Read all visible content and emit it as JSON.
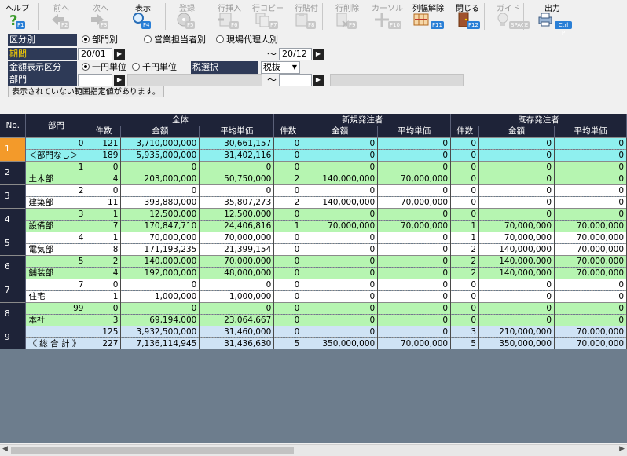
{
  "toolbar": [
    {
      "label": "ヘルプ",
      "key": "F1",
      "icon": "help-icon",
      "enabled": true
    },
    {
      "label": "前へ",
      "key": "F2",
      "icon": "arrow-left-icon",
      "enabled": false
    },
    {
      "label": "次へ",
      "key": "F3",
      "icon": "arrow-right-icon",
      "enabled": false
    },
    {
      "label": "表示",
      "key": "F4",
      "icon": "search-icon",
      "enabled": true
    },
    {
      "label": "登録",
      "key": "F5",
      "icon": "disk-icon",
      "enabled": false
    },
    {
      "label": "行挿入",
      "key": "F6",
      "icon": "row-insert-icon",
      "enabled": false
    },
    {
      "label": "行コピー",
      "key": "F7",
      "icon": "row-copy-icon",
      "enabled": false
    },
    {
      "label": "行貼付",
      "key": "F8",
      "icon": "row-paste-icon",
      "enabled": false
    },
    {
      "label": "行削除",
      "key": "F9",
      "icon": "row-delete-icon",
      "enabled": false
    },
    {
      "label": "カーソル",
      "key": "F10",
      "icon": "cursor-icon",
      "enabled": false
    },
    {
      "label": "列幅解除",
      "key": "F11",
      "icon": "column-width-icon",
      "enabled": true
    },
    {
      "label": "閉じる",
      "key": "F12",
      "icon": "door-icon",
      "enabled": true
    },
    {
      "label": "ガイド",
      "key": "SPACE",
      "icon": "bulb-icon",
      "enabled": false
    },
    {
      "label": "出力",
      "key": "Ctrl P",
      "icon": "output-icon",
      "enabled": true
    }
  ],
  "form": {
    "kubun_label": "区分別",
    "kubun_options": [
      "部門別",
      "営業担当者別",
      "現場代理人別"
    ],
    "kikan_label": "期間",
    "kikan_from": "20/01",
    "kikan_to": "20/12",
    "tilde": "～",
    "kingaku_label": "金額表示区分",
    "kingaku_options": [
      "一円単位",
      "千円単位"
    ],
    "zei_label": "税選択",
    "zei_value": "税抜",
    "bumon_label": "部門",
    "bumon_from": "",
    "bumon_to": "",
    "note": "表示されていない範囲指定値があります。"
  },
  "grid": {
    "h_no": "No.",
    "h_bumon": "部門",
    "groups": [
      "全体",
      "新規発注者",
      "既存発注者"
    ],
    "sub": [
      "件数",
      "金額",
      "平均単価"
    ],
    "rows": [
      {
        "no": "1",
        "code": "0",
        "name": "＜部門なし＞",
        "style": "cyan",
        "top": [
          "121",
          "3,710,000,000",
          "30,661,157",
          "0",
          "0",
          "0",
          "0",
          "0",
          "0"
        ],
        "bot": [
          "189",
          "5,935,000,000",
          "31,402,116",
          "0",
          "0",
          "0",
          "0",
          "0",
          "0"
        ]
      },
      {
        "no": "2",
        "code": "1",
        "name": "土木部",
        "style": "green",
        "top": [
          "0",
          "0",
          "0",
          "0",
          "0",
          "0",
          "0",
          "0",
          "0"
        ],
        "bot": [
          "4",
          "203,000,000",
          "50,750,000",
          "2",
          "140,000,000",
          "70,000,000",
          "0",
          "0",
          "0"
        ]
      },
      {
        "no": "3",
        "code": "2",
        "name": "建築部",
        "style": "white",
        "top": [
          "0",
          "0",
          "0",
          "0",
          "0",
          "0",
          "0",
          "0",
          "0"
        ],
        "bot": [
          "11",
          "393,880,000",
          "35,807,273",
          "2",
          "140,000,000",
          "70,000,000",
          "0",
          "0",
          "0"
        ]
      },
      {
        "no": "4",
        "code": "3",
        "name": "設備部",
        "style": "green",
        "top": [
          "1",
          "12,500,000",
          "12,500,000",
          "0",
          "0",
          "0",
          "0",
          "0",
          "0"
        ],
        "bot": [
          "7",
          "170,847,710",
          "24,406,816",
          "1",
          "70,000,000",
          "70,000,000",
          "1",
          "70,000,000",
          "70,000,000"
        ]
      },
      {
        "no": "5",
        "code": "4",
        "name": "電気部",
        "style": "white",
        "top": [
          "1",
          "70,000,000",
          "70,000,000",
          "0",
          "0",
          "0",
          "1",
          "70,000,000",
          "70,000,000"
        ],
        "bot": [
          "8",
          "171,193,235",
          "21,399,154",
          "0",
          "0",
          "0",
          "2",
          "140,000,000",
          "70,000,000"
        ]
      },
      {
        "no": "6",
        "code": "5",
        "name": "舗装部",
        "style": "green",
        "top": [
          "2",
          "140,000,000",
          "70,000,000",
          "0",
          "0",
          "0",
          "2",
          "140,000,000",
          "70,000,000"
        ],
        "bot": [
          "4",
          "192,000,000",
          "48,000,000",
          "0",
          "0",
          "0",
          "2",
          "140,000,000",
          "70,000,000"
        ]
      },
      {
        "no": "7",
        "code": "7",
        "name": "住宅",
        "style": "white",
        "top": [
          "0",
          "0",
          "0",
          "0",
          "0",
          "0",
          "0",
          "0",
          "0"
        ],
        "bot": [
          "1",
          "1,000,000",
          "1,000,000",
          "0",
          "0",
          "0",
          "0",
          "0",
          "0"
        ]
      },
      {
        "no": "8",
        "code": "99",
        "name": "本社",
        "style": "green",
        "top": [
          "0",
          "0",
          "0",
          "0",
          "0",
          "0",
          "0",
          "0",
          "0"
        ],
        "bot": [
          "3",
          "69,194,000",
          "23,064,667",
          "0",
          "0",
          "0",
          "0",
          "0",
          "0"
        ]
      },
      {
        "no": "9",
        "code": "",
        "name": "《 総 合 計 》",
        "style": "blue",
        "top": [
          "125",
          "3,932,500,000",
          "31,460,000",
          "0",
          "0",
          "0",
          "3",
          "210,000,000",
          "70,000,000"
        ],
        "bot": [
          "227",
          "7,136,114,945",
          "31,436,630",
          "5",
          "350,000,000",
          "70,000,000",
          "5",
          "350,000,000",
          "70,000,000"
        ]
      }
    ]
  }
}
